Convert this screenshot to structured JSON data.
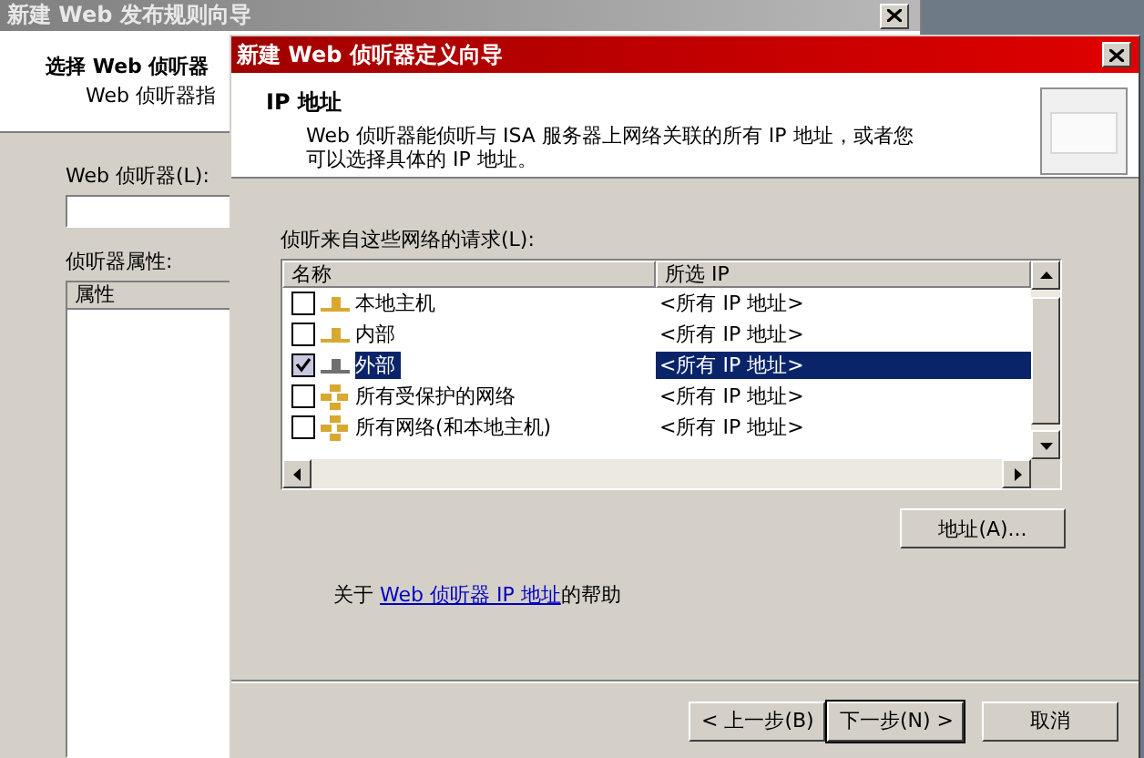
{
  "background_window": {
    "title": "新建 Web 发布规则向导",
    "header_title": "选择 Web 侦听器",
    "header_subtitle": "Web 侦听器指",
    "listener_label": "Web 侦听器(L):",
    "properties_label": "侦听器属性:",
    "properties_column": "属性"
  },
  "dialog": {
    "title": "新建 Web 侦听器定义向导",
    "header_title": "IP 地址",
    "header_description": "Web 侦听器能侦听与 ISA 服务器上网络关联的所有 IP 地址，或者您可以选择具体的 IP 地址。",
    "list_label": "侦听来自这些网络的请求(L):",
    "columns": [
      "名称",
      "所选 IP"
    ],
    "rows": [
      {
        "name": "本地主机",
        "ip": "<所有 IP 地址>",
        "checked": false,
        "selected": false,
        "kind": "single",
        "color": "#d8a830"
      },
      {
        "name": "内部",
        "ip": "<所有 IP 地址>",
        "checked": false,
        "selected": false,
        "kind": "single",
        "color": "#d8a830"
      },
      {
        "name": "外部",
        "ip": "<所有 IP 地址>",
        "checked": true,
        "selected": true,
        "kind": "single",
        "color": "#707070"
      },
      {
        "name": "所有受保护的网络",
        "ip": "<所有 IP 地址>",
        "checked": false,
        "selected": false,
        "kind": "set",
        "color": "#d8a830"
      },
      {
        "name": "所有网络(和本地主机)",
        "ip": "<所有 IP 地址>",
        "checked": false,
        "selected": false,
        "kind": "set",
        "color": "#d8a830"
      }
    ],
    "address_button": "地址(A)...",
    "help": {
      "prefix": "关于 ",
      "link": "Web 侦听器 IP 地址",
      "suffix": "的帮助"
    },
    "buttons": [
      {
        "label": "< 上一步(B)",
        "kind": "normal"
      },
      {
        "label": "下一步(N) >",
        "kind": "default"
      },
      {
        "label": "取消",
        "kind": "cancel"
      }
    ]
  }
}
